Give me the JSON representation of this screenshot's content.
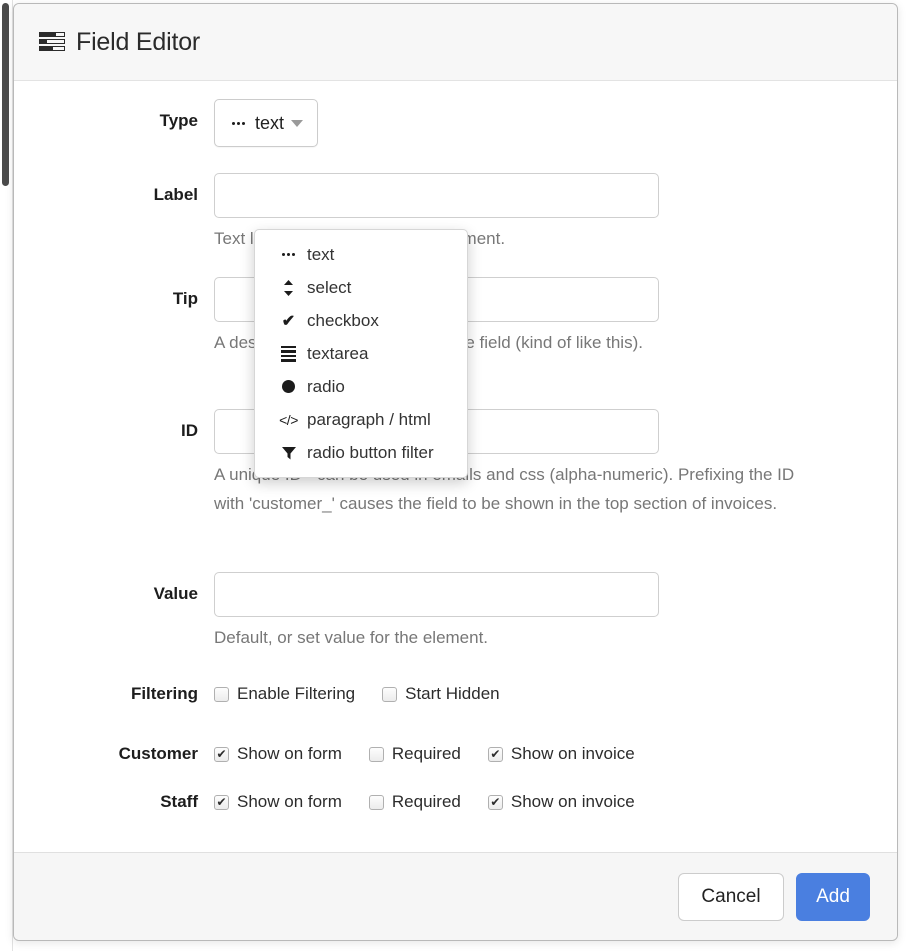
{
  "window": {
    "title": "Field Editor",
    "title_icon": "form-list-icon"
  },
  "type_row": {
    "label": "Type",
    "selected_value": "text",
    "selected_icon": "dots-icon",
    "caret_icon": "chevron-down-icon"
  },
  "dropdown": {
    "open": true,
    "items": [
      {
        "label": "text",
        "icon": "dots-icon"
      },
      {
        "label": "select",
        "icon": "up-down-arrows-icon"
      },
      {
        "label": "checkbox",
        "icon": "check-icon"
      },
      {
        "label": "textarea",
        "icon": "lines-icon"
      },
      {
        "label": "radio",
        "icon": "filled-circle-icon"
      },
      {
        "label": "paragraph / html",
        "icon": "code-brackets-icon"
      },
      {
        "label": "radio button filter",
        "icon": "funnel-filter-icon"
      }
    ]
  },
  "fields": [
    {
      "label": "Label",
      "value": "",
      "help": "Text label associated with the element."
    },
    {
      "label": "Tip",
      "value": "",
      "help": "A description or instructions for the field (kind of like this)."
    },
    {
      "label": "ID",
      "value": "",
      "help": "A unique ID - can be used in emails and css (alpha-numeric). Prefixing the ID with 'customer_' causes the field to be shown in the top section of invoices."
    },
    {
      "label": "Value",
      "value": "",
      "help": "Default, or set value for the element."
    }
  ],
  "checkbox_rows": [
    {
      "label": "Filtering",
      "options": [
        {
          "label": "Enable Filtering",
          "checked": false
        },
        {
          "label": "Start Hidden",
          "checked": false
        }
      ]
    },
    {
      "label": "Customer",
      "options": [
        {
          "label": "Show on form",
          "checked": true
        },
        {
          "label": "Required",
          "checked": false
        },
        {
          "label": "Show on invoice",
          "checked": true
        }
      ]
    },
    {
      "label": "Staff",
      "options": [
        {
          "label": "Show on form",
          "checked": true
        },
        {
          "label": "Required",
          "checked": false
        },
        {
          "label": "Show on invoice",
          "checked": true
        }
      ]
    }
  ],
  "footer": {
    "cancel_label": "Cancel",
    "add_label": "Add"
  },
  "colors": {
    "primary_button": "#4a7fe0",
    "header_background": "#f7f7f7",
    "footer_background": "#f6f6f6",
    "help_text": "#777777"
  }
}
